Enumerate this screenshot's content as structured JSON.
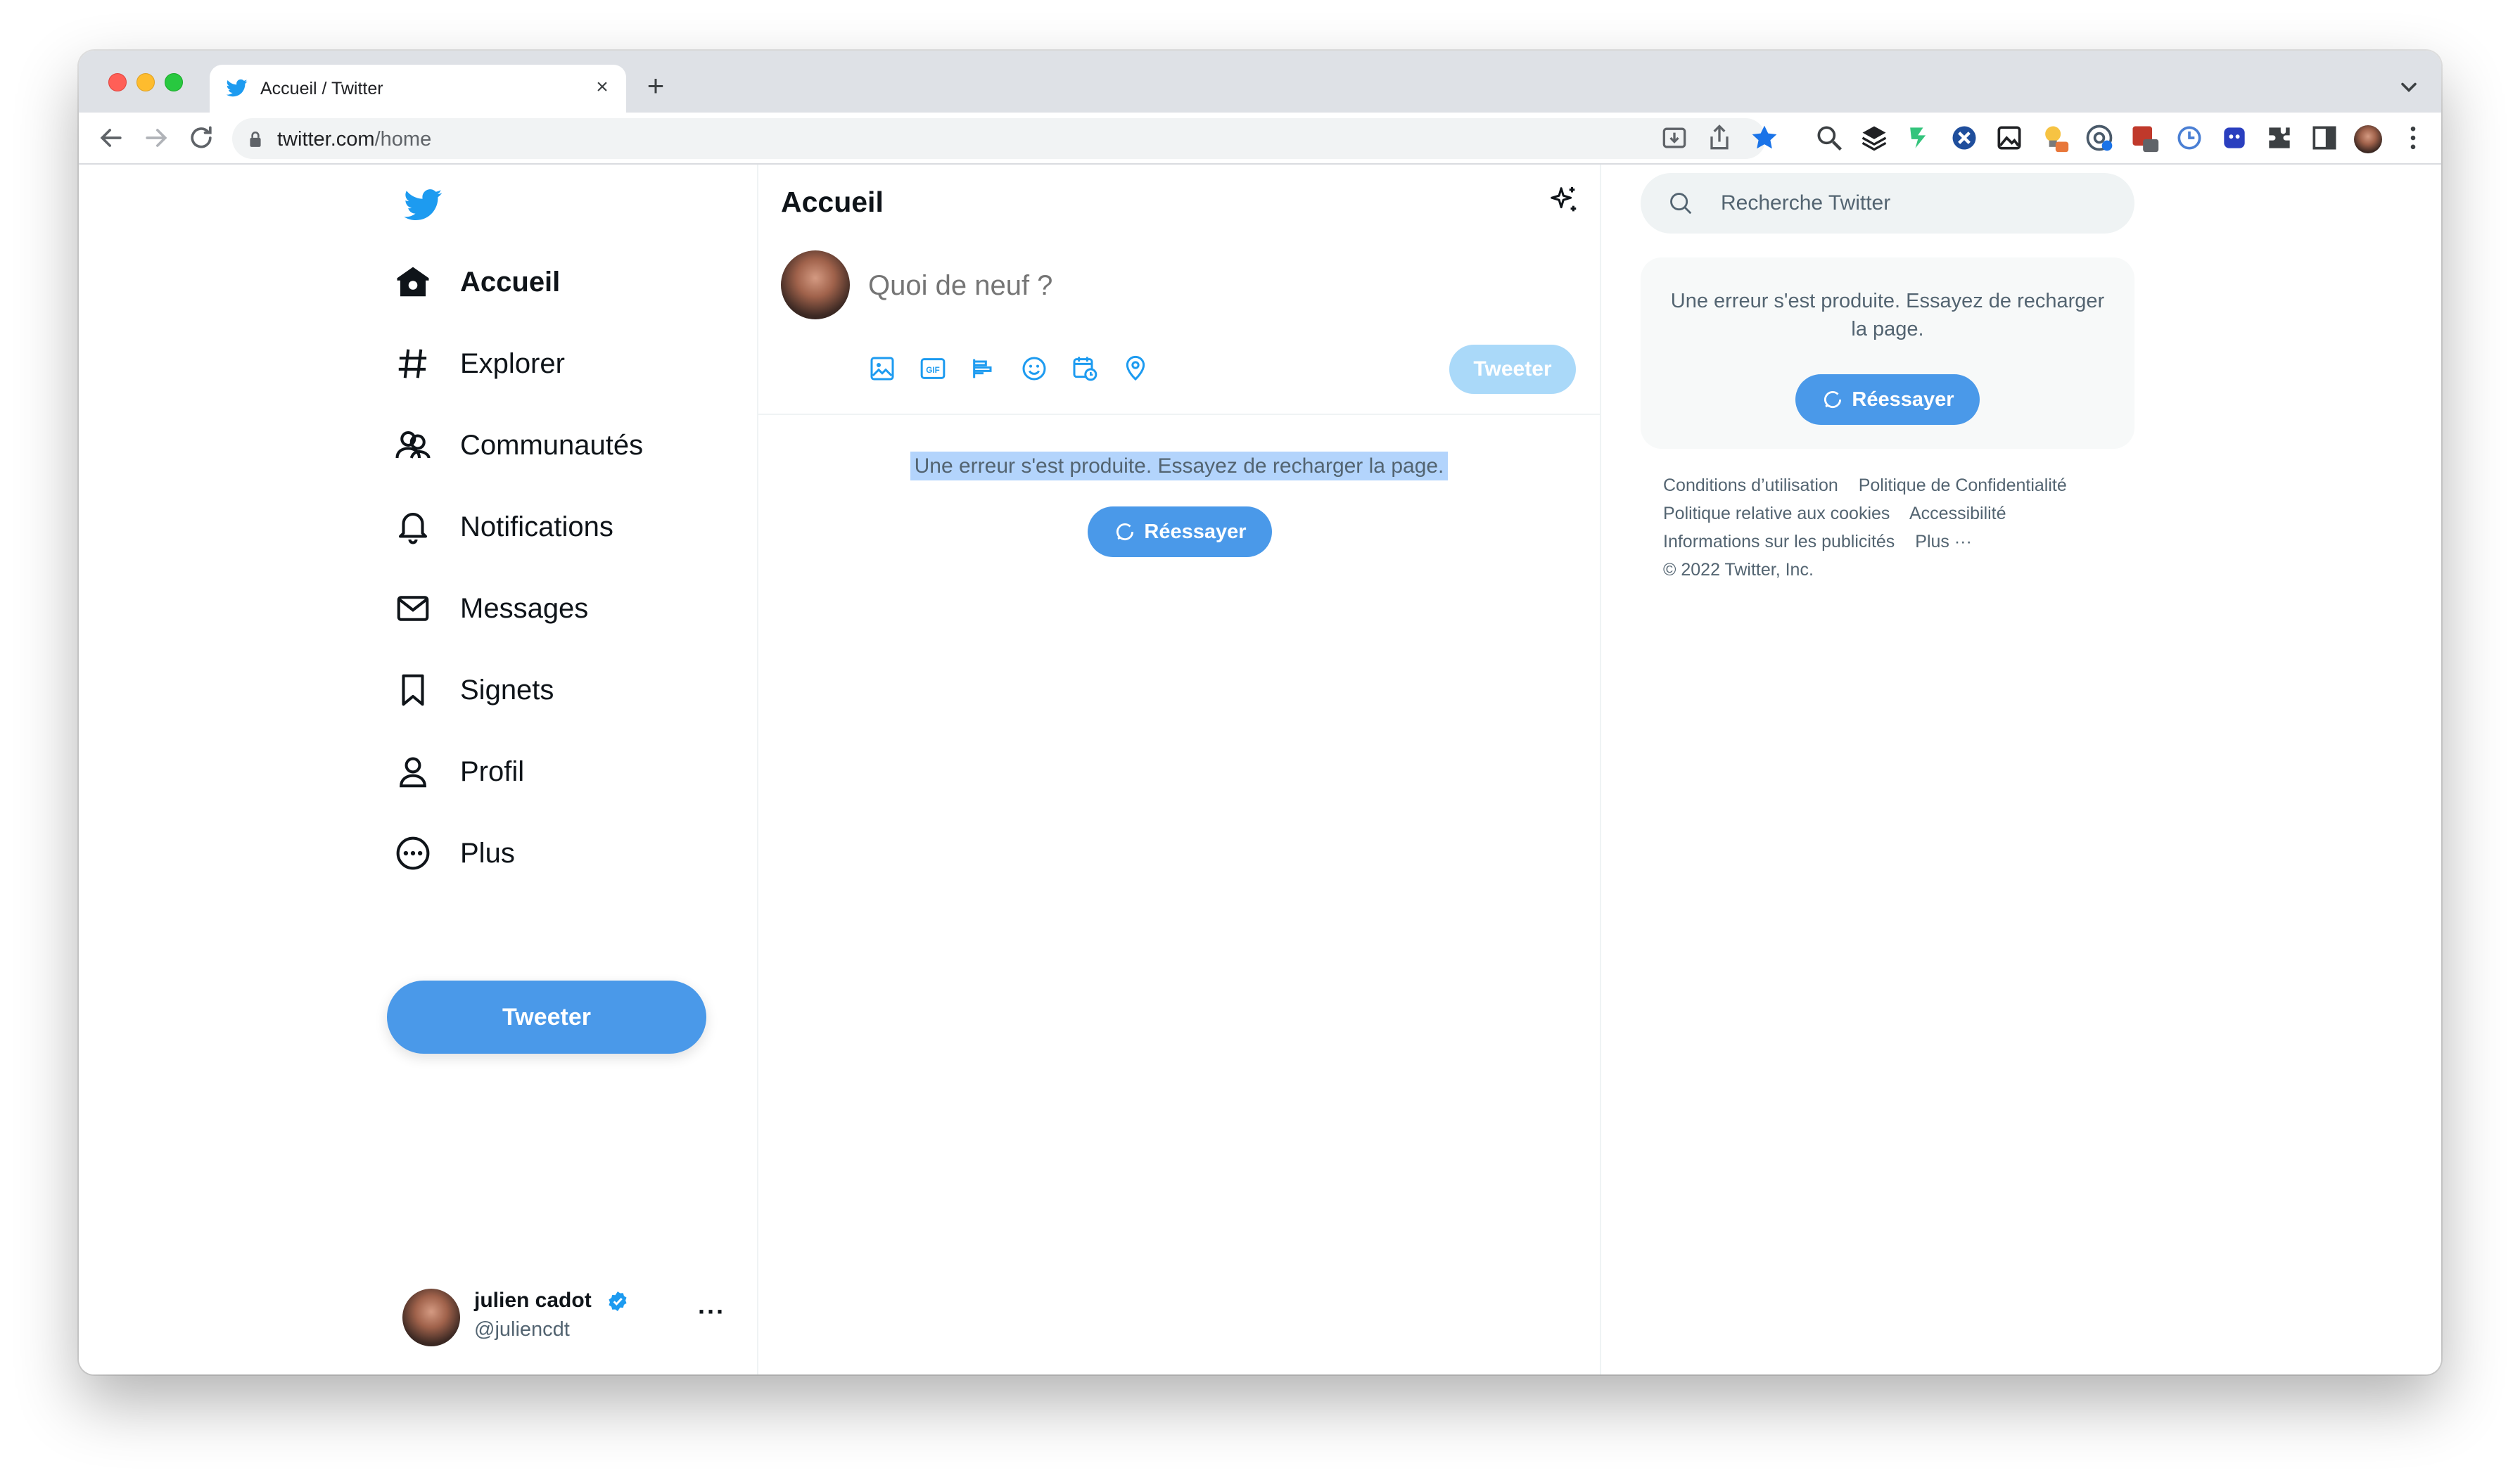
{
  "browser": {
    "tab_title": "Accueil / Twitter",
    "tab_close": "×",
    "new_tab": "+",
    "url_host": "twitter.com",
    "url_path": "/home"
  },
  "sidebar": {
    "items": [
      {
        "label": "Accueil",
        "icon": "home-icon",
        "active": true
      },
      {
        "label": "Explorer",
        "icon": "hashtag-icon"
      },
      {
        "label": "Communautés",
        "icon": "communities-icon"
      },
      {
        "label": "Notifications",
        "icon": "bell-icon"
      },
      {
        "label": "Messages",
        "icon": "envelope-icon"
      },
      {
        "label": "Signets",
        "icon": "bookmark-icon"
      },
      {
        "label": "Profil",
        "icon": "person-icon"
      },
      {
        "label": "Plus",
        "icon": "more-circle-icon"
      }
    ],
    "tweet_button": "Tweeter",
    "user": {
      "name": "julien cadot",
      "handle": "@juliencdt",
      "more": "···"
    }
  },
  "main": {
    "title": "Accueil",
    "composer_placeholder": "Quoi de neuf ?",
    "tweet_button": "Tweeter",
    "error_message": "Une erreur s'est produite. Essayez de recharger la page.",
    "retry_label": "Réessayer"
  },
  "right": {
    "search_placeholder": "Recherche Twitter",
    "error_message": "Une erreur s'est produite. Essayez de recharger la page.",
    "retry_label": "Réessayer",
    "footer": {
      "terms": "Conditions d’utilisation",
      "privacy": "Politique de Confidentialité",
      "cookies": "Politique relative aux cookies",
      "accessibility": "Accessibilité",
      "ads": "Informations sur les publicités",
      "more": "Plus ···",
      "copyright": "© 2022 Twitter, Inc."
    }
  },
  "colors": {
    "twitter_blue": "#1d9bf0",
    "button_blue": "#4a99e9",
    "text_secondary": "#536471"
  }
}
